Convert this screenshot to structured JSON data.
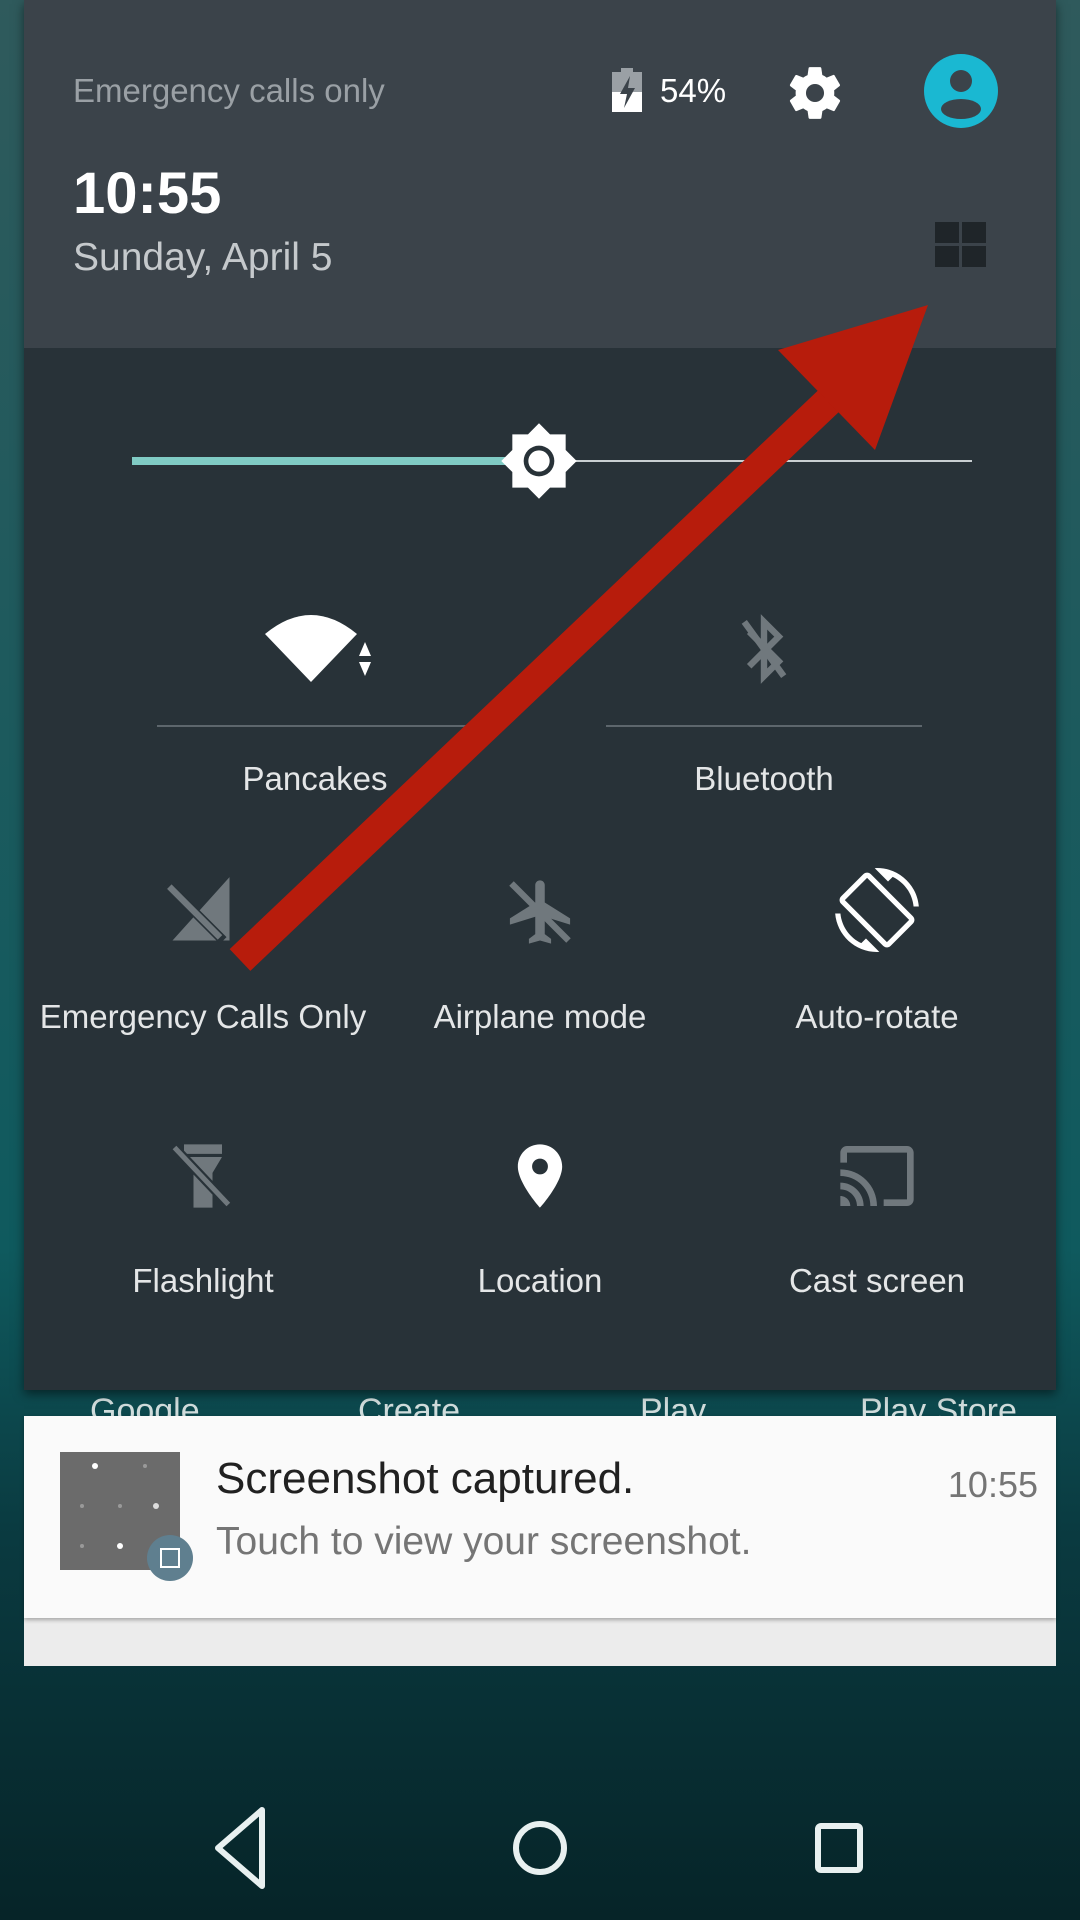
{
  "status": {
    "carrier": "Emergency calls only",
    "battery_percent": "54%",
    "battery_level": 54,
    "time": "10:55",
    "date": "Sunday, April 5"
  },
  "brightness": {
    "level_percent": 50,
    "accent": "#80cbc4"
  },
  "tiles": [
    {
      "label": "Pancakes",
      "icon": "wifi-icon",
      "active": true
    },
    {
      "label": "Bluetooth",
      "icon": "bluetooth-off-icon",
      "active": false
    },
    {
      "label": "Emergency Calls Only",
      "icon": "cellular-off-icon",
      "active": false
    },
    {
      "label": "Airplane mode",
      "icon": "airplane-off-icon",
      "active": false
    },
    {
      "label": "Auto-rotate",
      "icon": "auto-rotate-icon",
      "active": true
    },
    {
      "label": "Flashlight",
      "icon": "flashlight-off-icon",
      "active": false
    },
    {
      "label": "Location",
      "icon": "location-icon",
      "active": true
    },
    {
      "label": "Cast screen",
      "icon": "cast-icon",
      "active": false
    }
  ],
  "home_labels": [
    "Google",
    "Create",
    "Play",
    "Play Store"
  ],
  "notification": {
    "title": "Screenshot captured.",
    "text": "Touch to view your screenshot.",
    "time": "10:55"
  },
  "colors": {
    "header_bg": "#3b434a",
    "panel_bg": "#283238",
    "avatar": "#1ab8d2",
    "arrow": "#b71c0c"
  }
}
